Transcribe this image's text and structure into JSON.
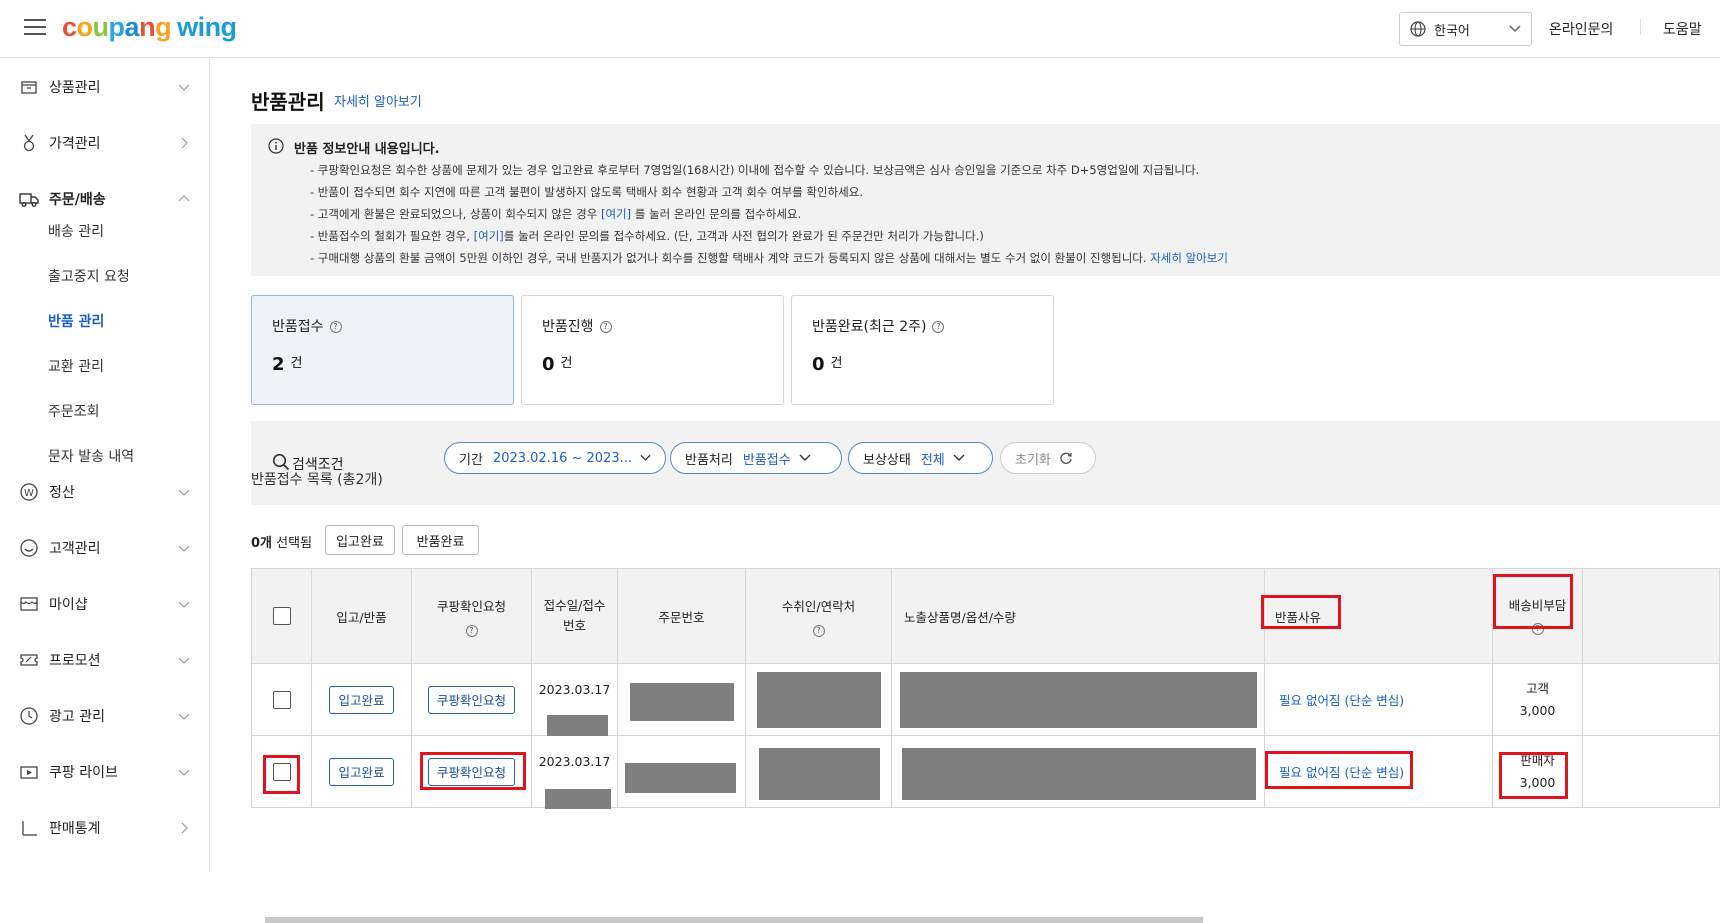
{
  "topbar": {
    "logo_letters": [
      "c",
      "o",
      "u",
      "p",
      "a",
      "n",
      "g"
    ],
    "logo_wing": "wing",
    "language": "한국어",
    "inquiry_link": "온라인문의",
    "help_link": "도움말"
  },
  "sidebar": {
    "items": [
      {
        "label": "상품관리",
        "icon": "box-icon"
      },
      {
        "label": "가격관리",
        "icon": "medal-icon"
      },
      {
        "label": "주문/배송",
        "icon": "truck-icon"
      },
      {
        "label": "정산",
        "icon": "won-icon"
      },
      {
        "label": "고객관리",
        "icon": "smile-icon"
      },
      {
        "label": "마이샵",
        "icon": "shop-icon"
      },
      {
        "label": "프로모션",
        "icon": "ticket-icon"
      },
      {
        "label": "광고 관리",
        "icon": "clock-icon"
      },
      {
        "label": "쿠팡 라이브",
        "icon": "tv-icon"
      },
      {
        "label": "판매통계",
        "icon": "chart-icon"
      }
    ],
    "subitems": [
      "배송 관리",
      "출고중지 요청",
      "반품 관리",
      "교환 관리",
      "주문조회",
      "문자 발송 내역"
    ]
  },
  "page": {
    "title": "반품관리",
    "help": "자세히 알아보기"
  },
  "notice": {
    "title": "반품 정보안내 내용입니다.",
    "line1": "- 쿠팡확인요청은 회수한 상품에 문제가 있는 경우 입고완료 후로부터 7영업일(168시간) 이내에 접수할 수 있습니다. 보상금액은 심사 승인일을 기준으로 차주 D+5영업일에 지급됩니다.",
    "line2": "- 반품이 접수되면 회수 지연에 따른 고객 불편이 발생하지 않도록 택배사 회수 현황과 고객 회수 여부를 확인하세요.",
    "line3a": "- 고객에게 환불은 완료되었으나, 상품이 회수되지 않은 경우 ",
    "line3link": "[여기]",
    "line3b": " 를 눌러 온라인 문의를 접수하세요.",
    "line4a": "- 반품접수의 철회가 필요한 경우, ",
    "line4link": "[여기]",
    "line4b": "를 눌러 온라인 문의를 접수하세요. (단, 고객과 사전 협의가 완료가 된 주문건만 처리가 가능합니다.)",
    "line5a": "- 구매대행 상품의 환불 금액이 5만원 이하인 경우, 국내 반품지가 없거나 회수를 진행할 택배사 계약 코드가 등록되지 않은 상품에 대해서는 별도 수거 없이 환불이 진행됩니다. ",
    "line5link": "자세히 알아보기"
  },
  "stats": [
    {
      "label": "반품접수",
      "value": "2",
      "unit": "건"
    },
    {
      "label": "반품진행",
      "value": "0",
      "unit": "건"
    },
    {
      "label": "반품완료(최근 2주)",
      "value": "0",
      "unit": "건"
    }
  ],
  "search": {
    "title": "검색조건",
    "filters": [
      {
        "key": "기간",
        "value": "2023.02.16 ~ 2023..."
      },
      {
        "key": "반품처리",
        "value": "반품접수"
      },
      {
        "key": "보상상태",
        "value": "전체"
      }
    ],
    "reset": "초기화"
  },
  "list": {
    "title": "반품접수 목록 (총",
    "count": "2개",
    "close": ")",
    "selected_count": "0개",
    "selected_label": "선택됨",
    "btn_receive": "입고완료",
    "btn_return_done": "반품완료"
  },
  "table": {
    "headers": {
      "inout": "입고/반품",
      "coupang_req": "쿠팡확인요청",
      "recv_date": "접수일/접수번호",
      "order_no": "주문번호",
      "recipient": "수취인/연락처",
      "product": "노출상품명/옵션/수량",
      "reason": "반품사유",
      "shipping_fee": "배송비부담"
    },
    "rows": [
      {
        "inout_btn": "입고완료",
        "req_btn": "쿠팡확인요청",
        "date": "2023.03.17",
        "reason": "필요 없어짐 (단순 변심)",
        "payer": "고객",
        "fee": "3,000"
      },
      {
        "inout_btn": "입고완료",
        "req_btn": "쿠팡확인요청",
        "date": "2023.03.17",
        "reason": "필요 없어짐 (단순 변심)",
        "payer": "판매자",
        "fee": "3,000"
      }
    ]
  },
  "colors": {
    "accent_blue": "#1a5fc2",
    "highlight_red": "#e0141e",
    "redaction_gray": "#7f7f7f"
  }
}
